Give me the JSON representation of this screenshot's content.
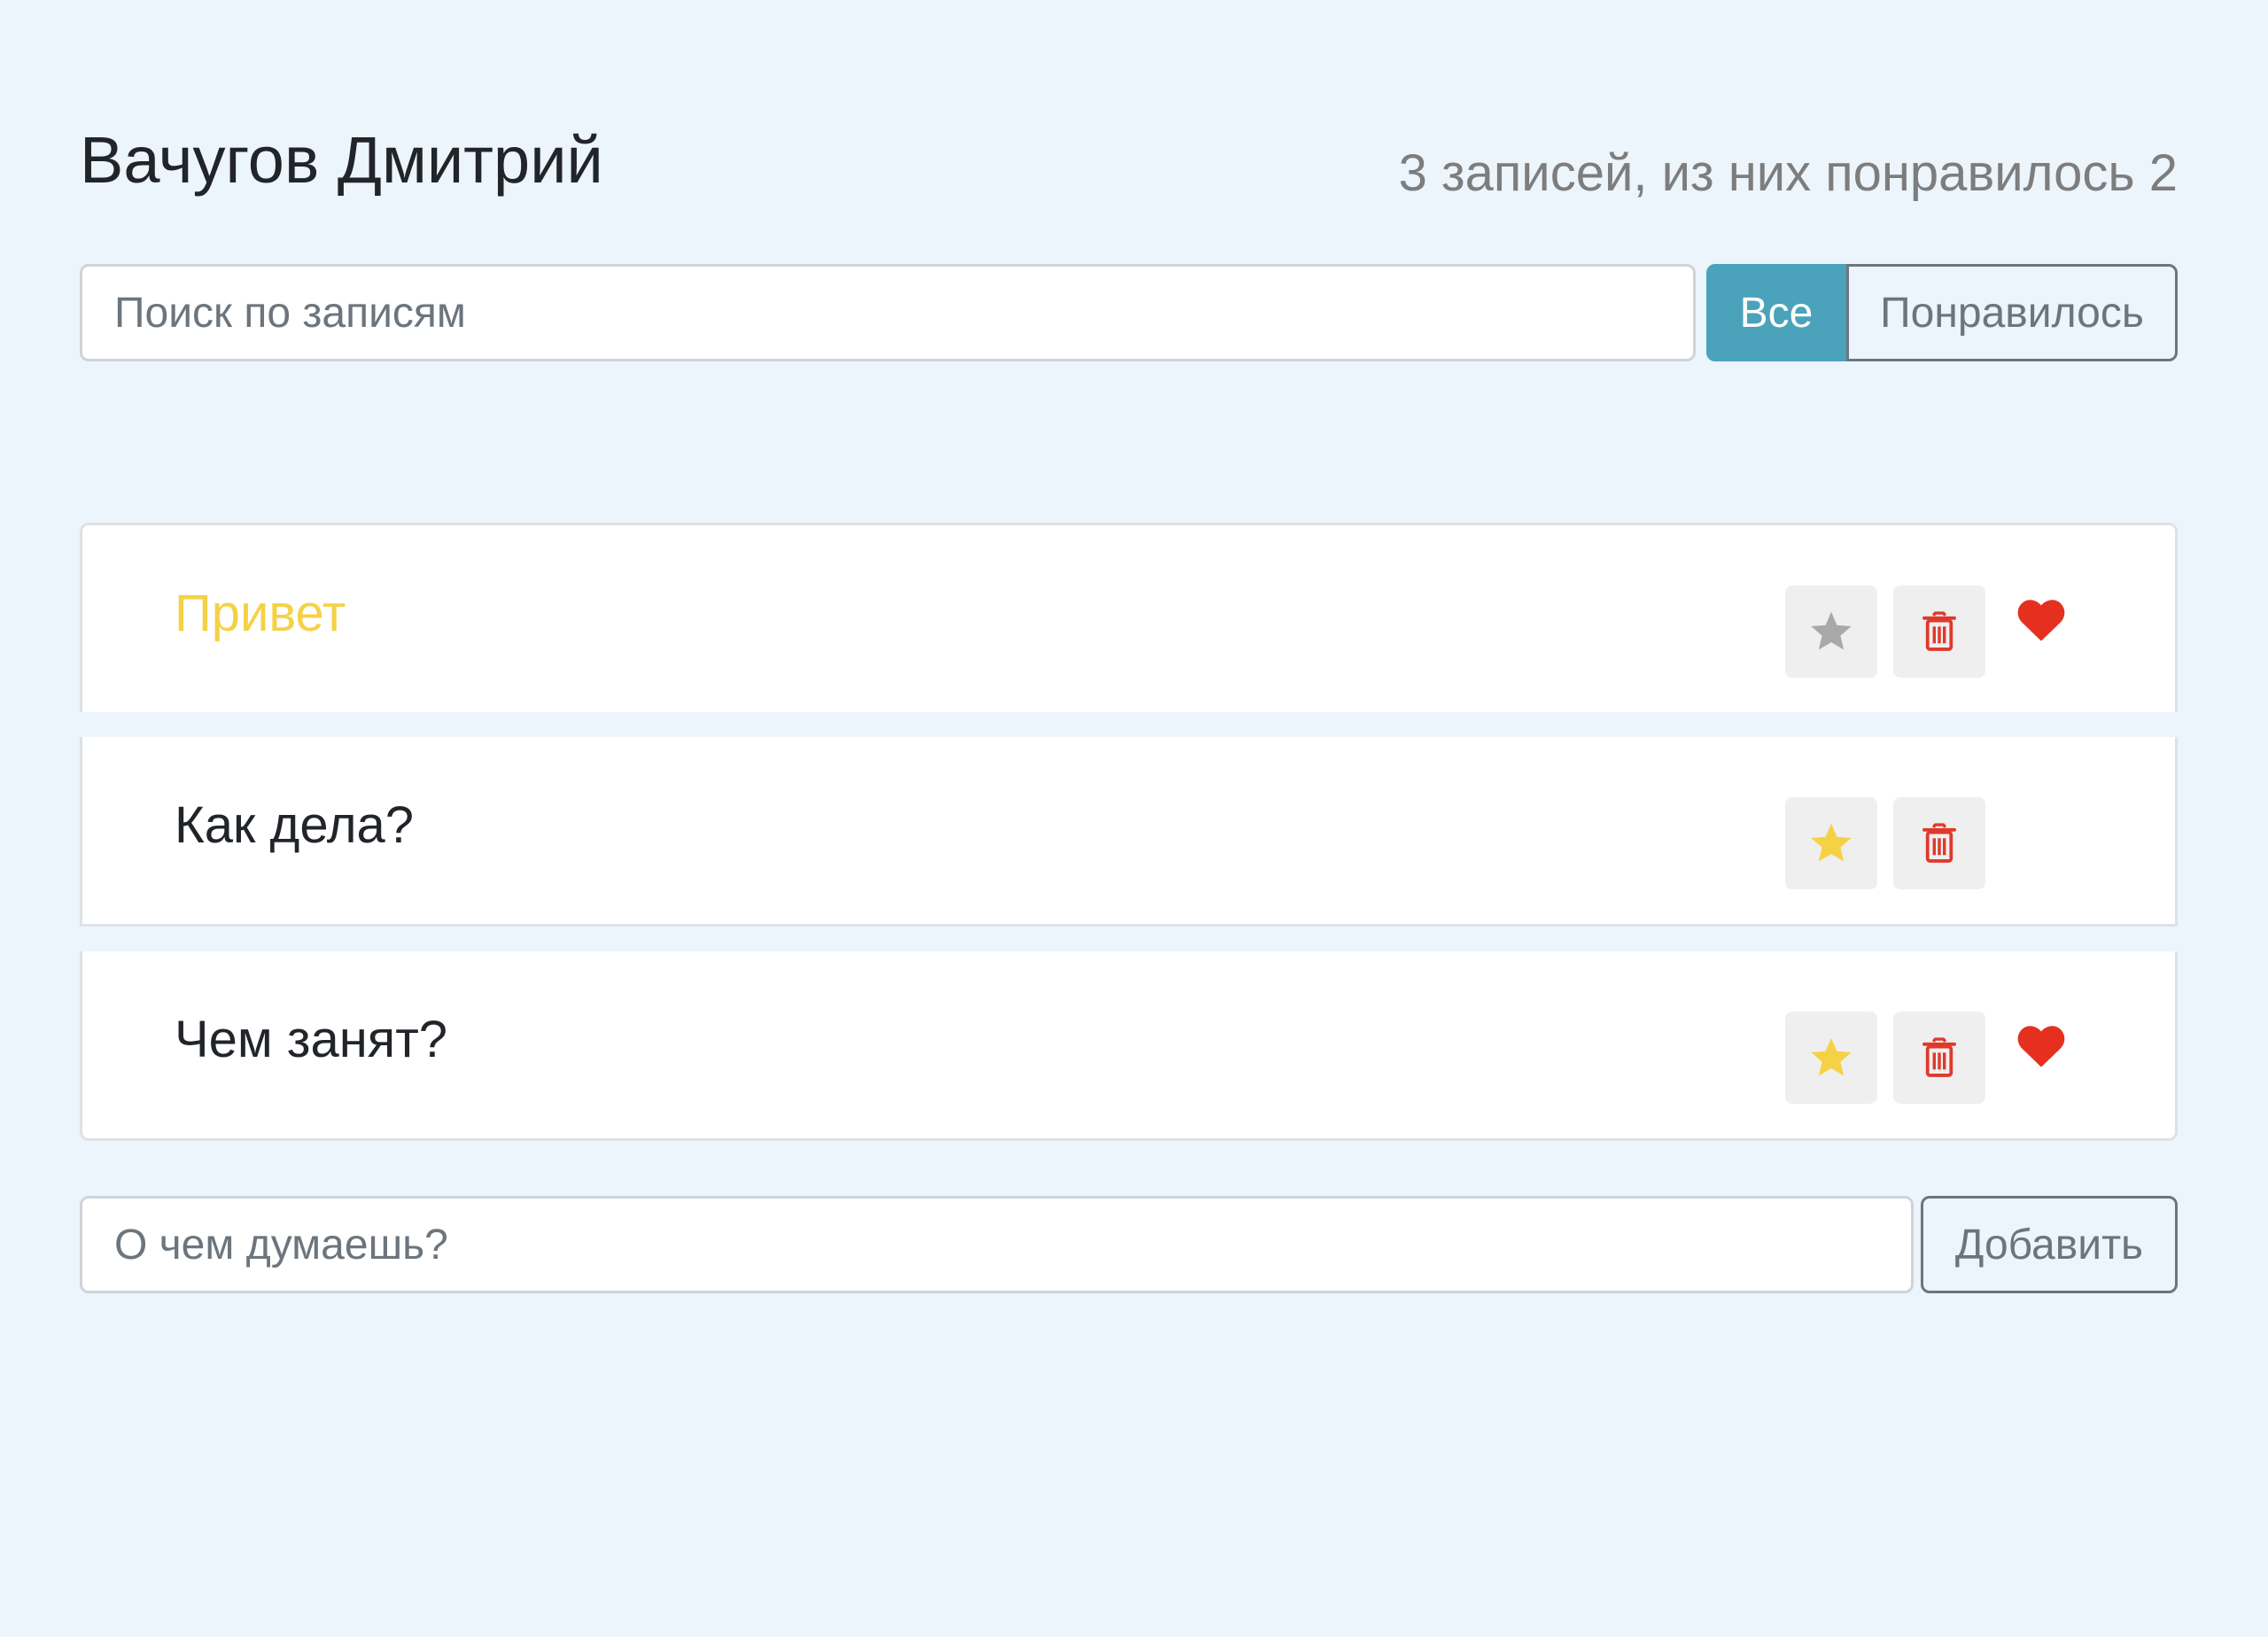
{
  "header": {
    "title": "Вачугов Дмитрий",
    "counter": "3 записей, из них понравилось 2"
  },
  "search": {
    "placeholder": "Поиск по записям",
    "value": ""
  },
  "filters": {
    "all_label": "Все",
    "liked_label": "Понравилось",
    "active": "all"
  },
  "items": [
    {
      "label": "Привет",
      "important": true,
      "liked": true
    },
    {
      "label": "Как дела?",
      "important": false,
      "liked": false
    },
    {
      "label": "Чем занят?",
      "important": false,
      "liked": true
    }
  ],
  "add_form": {
    "placeholder": "О чем думаешь?",
    "value": "",
    "button_label": "Добавить"
  },
  "icons": {
    "star": "star-icon",
    "trash": "trash-icon",
    "heart": "heart-icon"
  },
  "colors": {
    "background": "#ecf4fc",
    "accent": "#4aa3ba",
    "important_text": "#f5d245",
    "star_active": "#f5d245",
    "star_inactive": "#a9a9a9",
    "trash": "#e0392b",
    "heart": "#e6301f"
  }
}
